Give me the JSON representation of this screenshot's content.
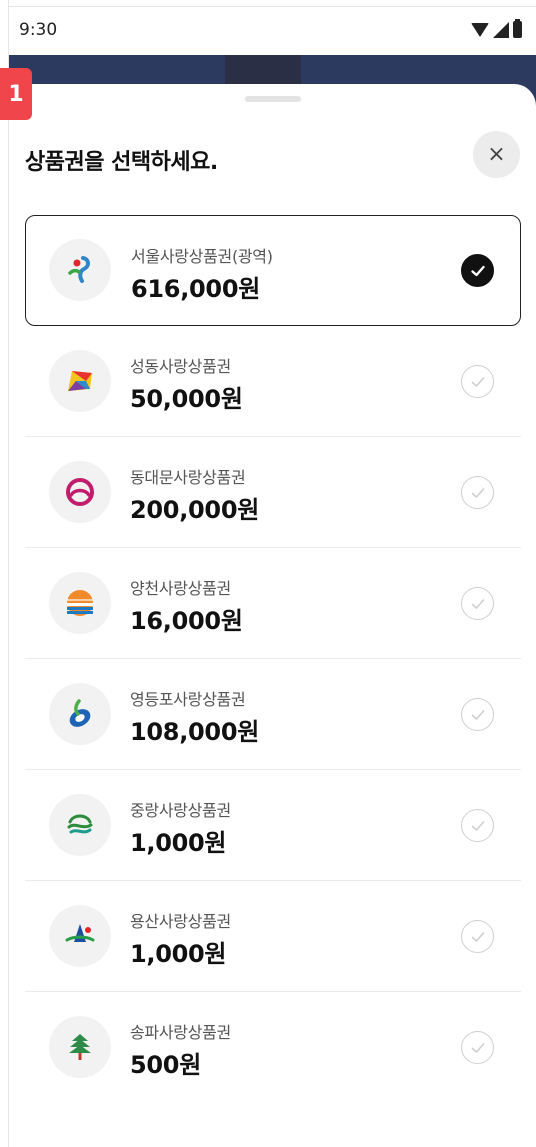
{
  "status_bar": {
    "time": "9:30"
  },
  "badge": {
    "label": "1"
  },
  "sheet": {
    "title": "상품권을 선택하세요.",
    "close_label": "×"
  },
  "vouchers": [
    {
      "name": "서울사랑상품권(광역)",
      "amount": "616,000원",
      "selected": true,
      "icon": "seoul-logo-icon"
    },
    {
      "name": "성동사랑상품권",
      "amount": "50,000원",
      "selected": false,
      "icon": "seongdong-logo-icon"
    },
    {
      "name": "동대문사랑상품권",
      "amount": "200,000원",
      "selected": false,
      "icon": "dongdaemun-logo-icon"
    },
    {
      "name": "양천사랑상품권",
      "amount": "16,000원",
      "selected": false,
      "icon": "yangcheon-logo-icon"
    },
    {
      "name": "영등포사랑상품권",
      "amount": "108,000원",
      "selected": false,
      "icon": "yeongdeungpo-logo-icon"
    },
    {
      "name": "중랑사랑상품권",
      "amount": "1,000원",
      "selected": false,
      "icon": "jungnang-logo-icon"
    },
    {
      "name": "용산사랑상품권",
      "amount": "1,000원",
      "selected": false,
      "icon": "yongsan-logo-icon"
    },
    {
      "name": "송파사랑상품권",
      "amount": "500원",
      "selected": false,
      "icon": "songpa-logo-icon"
    }
  ],
  "colors": {
    "badge": "#f0454a",
    "nav_background": "#2b3a5e",
    "selected_border": "#222222",
    "check_inactive": "#cfcfcf"
  }
}
